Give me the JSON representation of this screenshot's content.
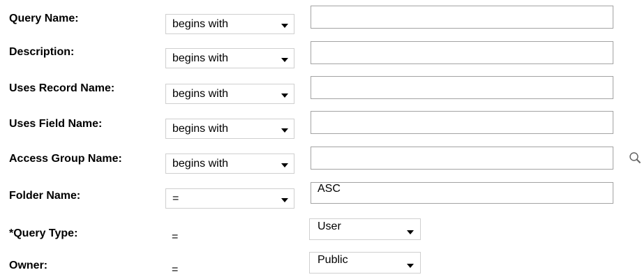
{
  "rows": [
    {
      "label": "Query Name:",
      "operator": "begins with",
      "value": ""
    },
    {
      "label": "Description:",
      "operator": "begins with",
      "value": ""
    },
    {
      "label": "Uses Record Name:",
      "operator": "begins with",
      "value": ""
    },
    {
      "label": "Uses Field Name:",
      "operator": "begins with",
      "value": ""
    },
    {
      "label": "Access Group Name:",
      "operator": "begins with",
      "value": "",
      "lookup_icon": "magnifying-glass-icon"
    },
    {
      "label": "Folder Name:",
      "operator": "=",
      "value": "ASC"
    },
    {
      "label": "*Query Type:",
      "operator": "=",
      "value": "User"
    },
    {
      "label": "Owner:",
      "operator": "=",
      "value": "Public"
    }
  ]
}
